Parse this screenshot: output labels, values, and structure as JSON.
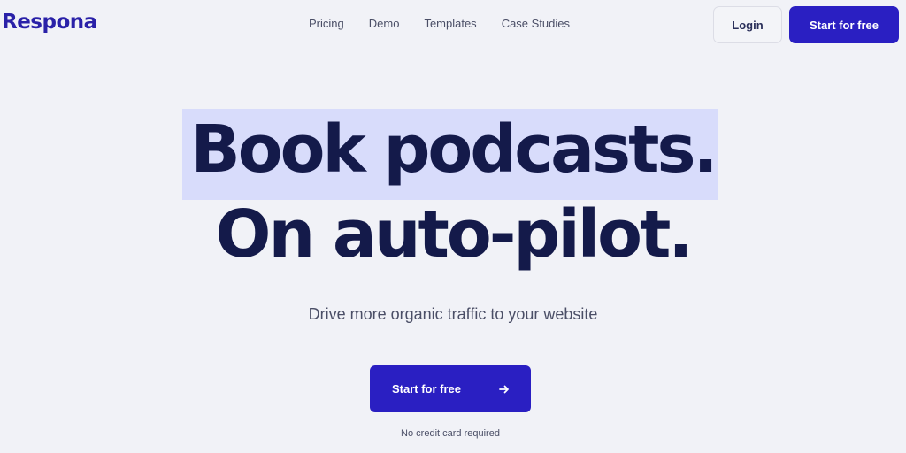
{
  "header": {
    "logo_text": "Respona",
    "nav": [
      "Pricing",
      "Demo",
      "Templates",
      "Case Studies"
    ],
    "login_label": "Login",
    "cta_label": "Start for free"
  },
  "hero": {
    "headline_line1": "Book podcasts.",
    "headline_line2": "On auto-pilot.",
    "subtitle": "Drive more organic traffic to your website",
    "cta_label": "Start for free",
    "cta_icon": "arrow-right-icon",
    "note": "No credit card required"
  },
  "colors": {
    "brand": "#2a1fc2",
    "highlight": "#d8dcfb",
    "background": "#f1f2f7",
    "heading": "#141a4a"
  }
}
